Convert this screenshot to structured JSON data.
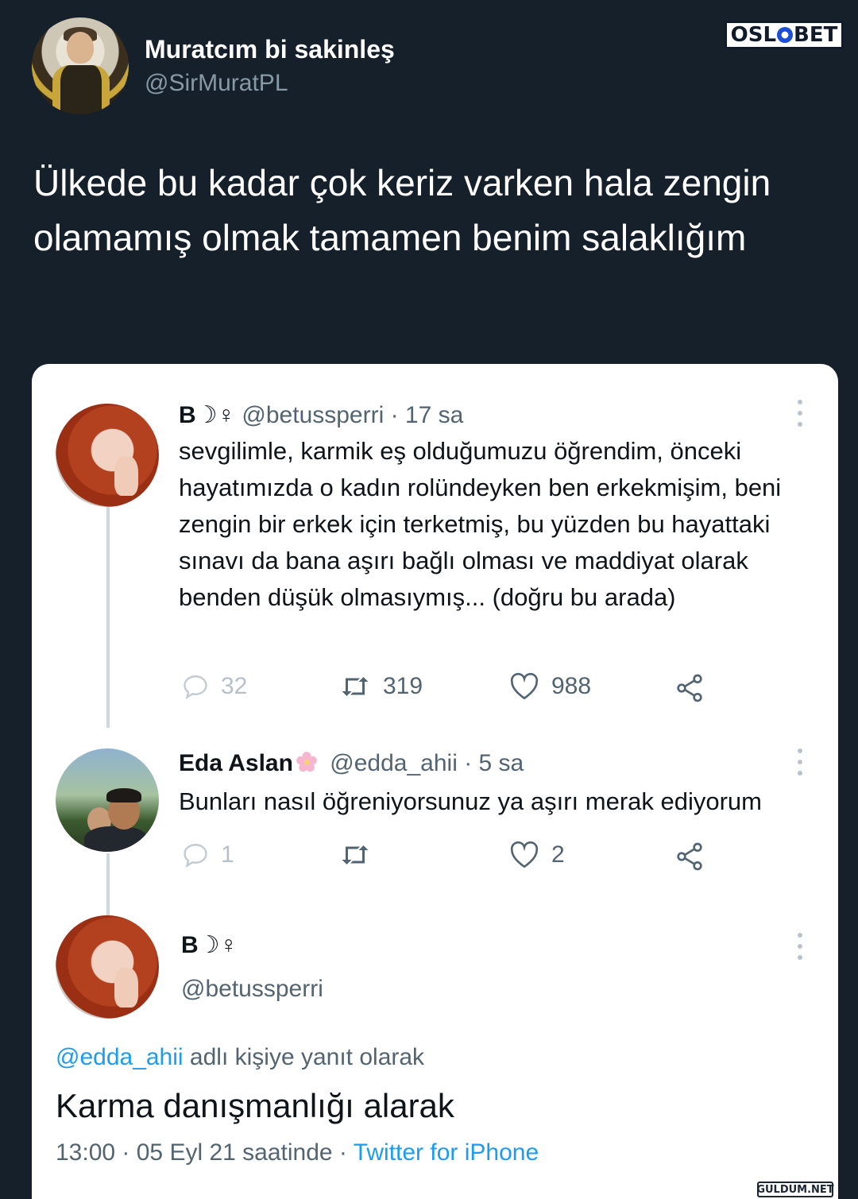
{
  "outer_tweet": {
    "display_name": "Muratcım bi sakinleş",
    "handle": "@SirMuratPL",
    "text": "Ülkede bu kadar çok keriz varken hala zengin olamamış olmak tamamen benim salaklığım"
  },
  "brand_logo": {
    "text_left": "OSL",
    "text_right": "BET"
  },
  "thread": [
    {
      "name": "B☽♀",
      "handle": "@betussperri",
      "time": "· 17 sa",
      "text": "sevgilimle, karmik eş olduğumuzu öğrendim, önceki hayatımızda o kadın rolündeyken ben erkekmişim, beni zengin bir erkek için terketmiş, bu yüzden bu hayattaki sınavı da bana aşırı bağlı olması ve maddiyat olarak benden düşük olmasıymış... (doğru bu arada)",
      "replies": "32",
      "retweets": "319",
      "likes": "988"
    },
    {
      "name": "Eda Aslan",
      "handle": "@edda_ahii",
      "time": "· 5 sa",
      "text": "Bunları nasıl öğreniyorsunuz ya aşırı merak ediyorum",
      "replies": "1",
      "retweets": "",
      "likes": "2"
    }
  ],
  "focused_tweet": {
    "name": "B☽♀",
    "handle": "@betussperri",
    "reply_to_mention": "@edda_ahii",
    "reply_to_suffix": " adlı kişiye yanıt olarak",
    "text": "Karma danışmanlığı alarak",
    "timestamp": "13:00 · 05 Eyl 21 saatinde · ",
    "source": "Twitter for iPhone"
  },
  "watermark": "GULDUM.NET",
  "colors": {
    "background": "#15202b",
    "card": "#ffffff",
    "link": "#1d9bf0",
    "secondary_text": "#536471"
  }
}
